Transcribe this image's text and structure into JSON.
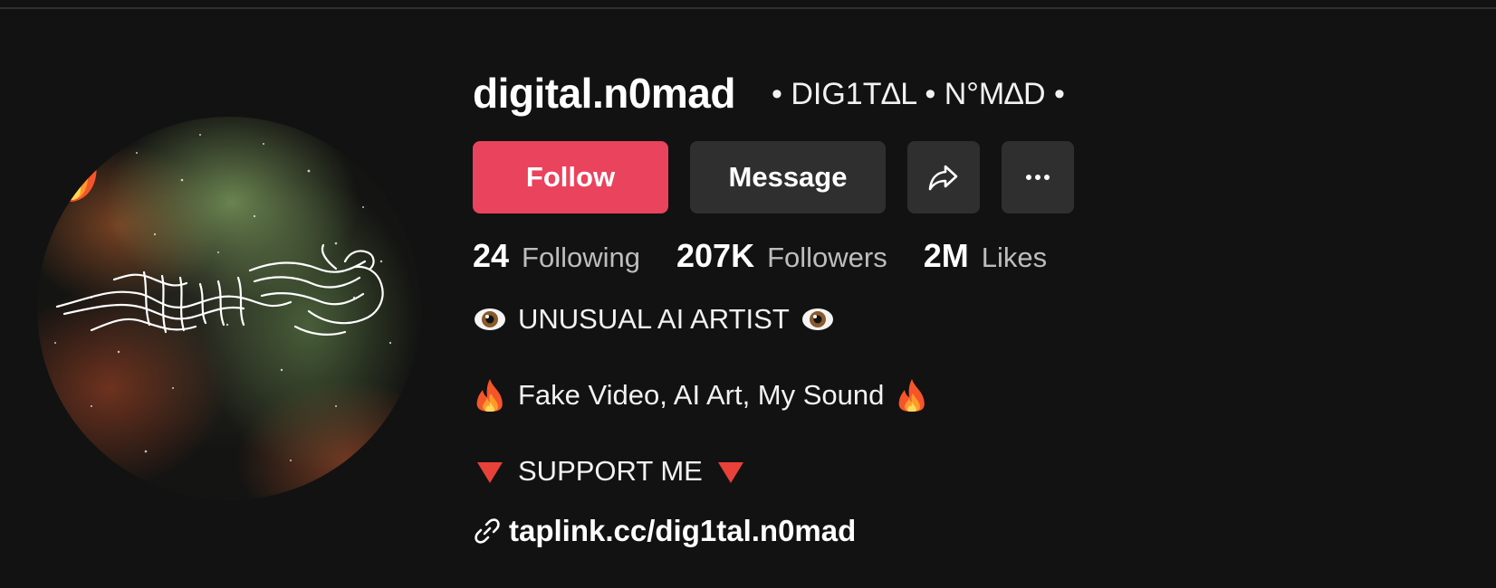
{
  "profile": {
    "username": "digital.n0mad",
    "display_name": "• DIG1T∆L • N°M∆D •"
  },
  "actions": {
    "follow_label": "Follow",
    "message_label": "Message",
    "share_icon": "share-arrow-icon",
    "more_icon": "more-horizontal-icon"
  },
  "stats": [
    {
      "value": "24",
      "label": "Following"
    },
    {
      "value": "207K",
      "label": "Followers"
    },
    {
      "value": "2M",
      "label": "Likes"
    }
  ],
  "bio": {
    "line1": "UNUSUAL AI ARTIST",
    "line1_icon": "eye-emoji",
    "line2": "Fake Video, AI Art, My Sound",
    "line2_icon": "fire-emoji",
    "line3": "SUPPORT ME",
    "line3_icon": "red-down-triangle-emoji"
  },
  "link": {
    "text": "taplink.cc/dig1tal.n0mad",
    "icon": "link-icon"
  },
  "colors": {
    "background": "#121212",
    "follow_button": "#ea435d",
    "secondary_button": "#2f2f2f",
    "muted_text": "#bdbdbd"
  }
}
